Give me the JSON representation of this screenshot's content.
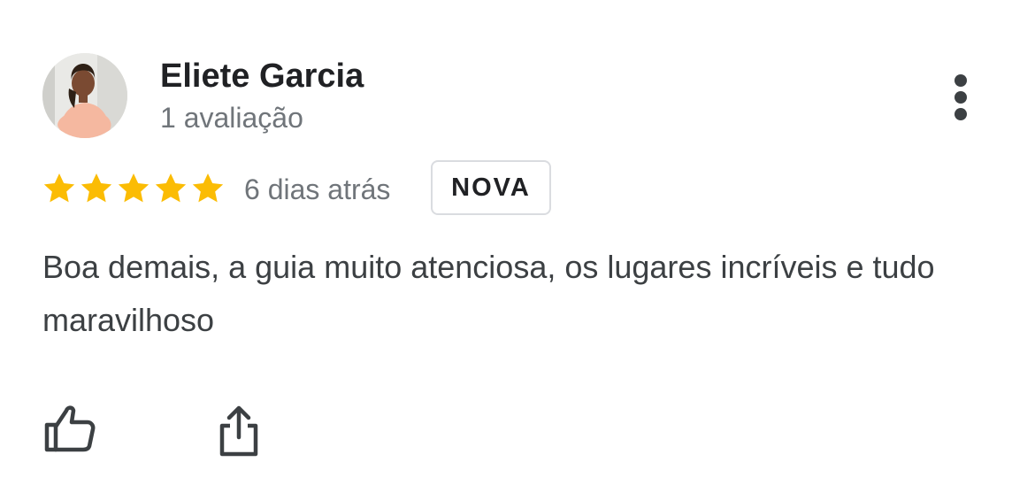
{
  "review": {
    "author_name": "Eliete Garcia",
    "author_meta": "1 avaliação",
    "rating": 5,
    "rating_max": 5,
    "date": "6 dias atrás",
    "badge": "NOVA",
    "text": "Boa demais, a guia muito atenciosa, os lugares incríveis e tudo maravilhoso"
  },
  "icons": {
    "more": "more-vert-icon",
    "star": "star-icon",
    "like": "thumbs-up-icon",
    "share": "share-icon"
  },
  "colors": {
    "star": "#FBBC04",
    "primary_text": "#202124",
    "secondary_text": "#70757a",
    "icon": "#3c4043"
  }
}
